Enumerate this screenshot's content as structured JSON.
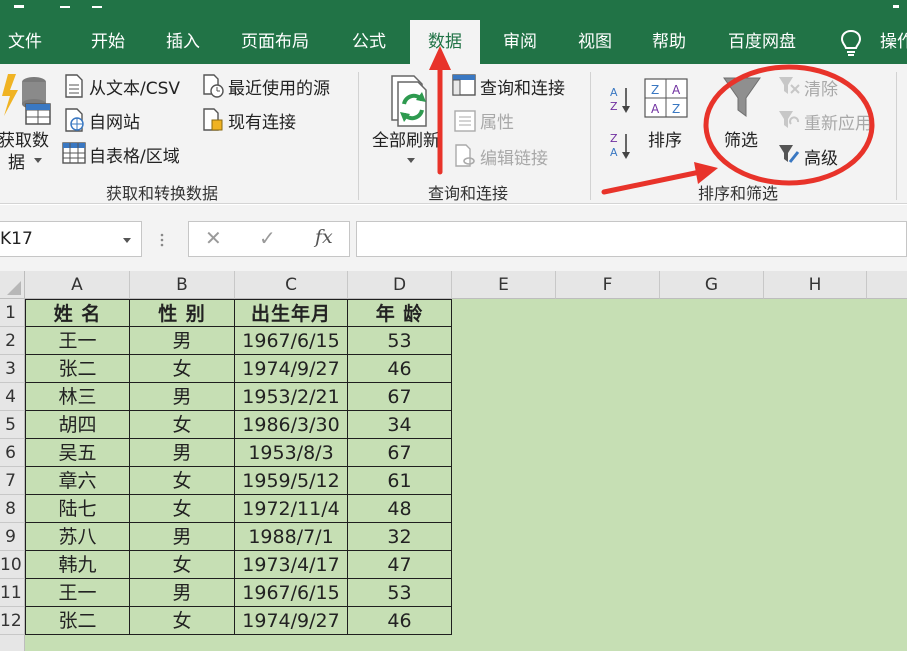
{
  "ribbon_tabs": [
    "文件",
    "开始",
    "插入",
    "页面布局",
    "公式",
    "数据",
    "审阅",
    "视图",
    "帮助",
    "百度网盘",
    "操作"
  ],
  "active_tab": "数据",
  "groups": {
    "get_transform": {
      "label": "获取和转换数据",
      "get_data": [
        "获取数",
        "据"
      ],
      "from_text_csv": "从文本/CSV",
      "from_web": "自网站",
      "from_table": "自表格/区域",
      "recent_sources": "最近使用的源",
      "existing_connections": "现有连接"
    },
    "queries": {
      "label": "查询和连接",
      "refresh_all": "全部刷新",
      "queries_connections": "查询和连接",
      "properties": "属性",
      "edit_links": "编辑链接"
    },
    "sort_filter": {
      "label": "排序和筛选",
      "sort": "排序",
      "filter": "筛选",
      "clear": "清除",
      "reapply": "重新应用",
      "advanced": "高级"
    }
  },
  "name_box": "K17",
  "formula_bar": {
    "cancel": "✕",
    "enter": "✓",
    "fx": "fx",
    "value": ""
  },
  "columns": [
    "A",
    "B",
    "C",
    "D",
    "E",
    "F",
    "G",
    "H"
  ],
  "row_numbers": [
    "1",
    "2",
    "3",
    "4",
    "5",
    "6",
    "7",
    "8",
    "9",
    "10",
    "11",
    "12"
  ],
  "table": {
    "headers": [
      "姓 名",
      "性 别",
      "出生年月",
      "年 龄"
    ],
    "rows": [
      [
        "王一",
        "男",
        "1967/6/15",
        "53"
      ],
      [
        "张二",
        "女",
        "1974/9/27",
        "46"
      ],
      [
        "林三",
        "男",
        "1953/2/21",
        "67"
      ],
      [
        "胡四",
        "女",
        "1986/3/30",
        "34"
      ],
      [
        "吴五",
        "男",
        "1953/8/3",
        "67"
      ],
      [
        "章六",
        "女",
        "1959/5/12",
        "61"
      ],
      [
        "陆七",
        "女",
        "1972/11/4",
        "48"
      ],
      [
        "苏八",
        "男",
        "1988/7/1",
        "32"
      ],
      [
        "韩九",
        "女",
        "1973/4/17",
        "47"
      ],
      [
        "王一",
        "男",
        "1967/6/15",
        "53"
      ],
      [
        "张二",
        "女",
        "1974/9/27",
        "46"
      ]
    ]
  },
  "colors": {
    "excel_green": "#217346",
    "sheet_fill": "#c6dfb4",
    "annotation_red": "#e8332a"
  }
}
